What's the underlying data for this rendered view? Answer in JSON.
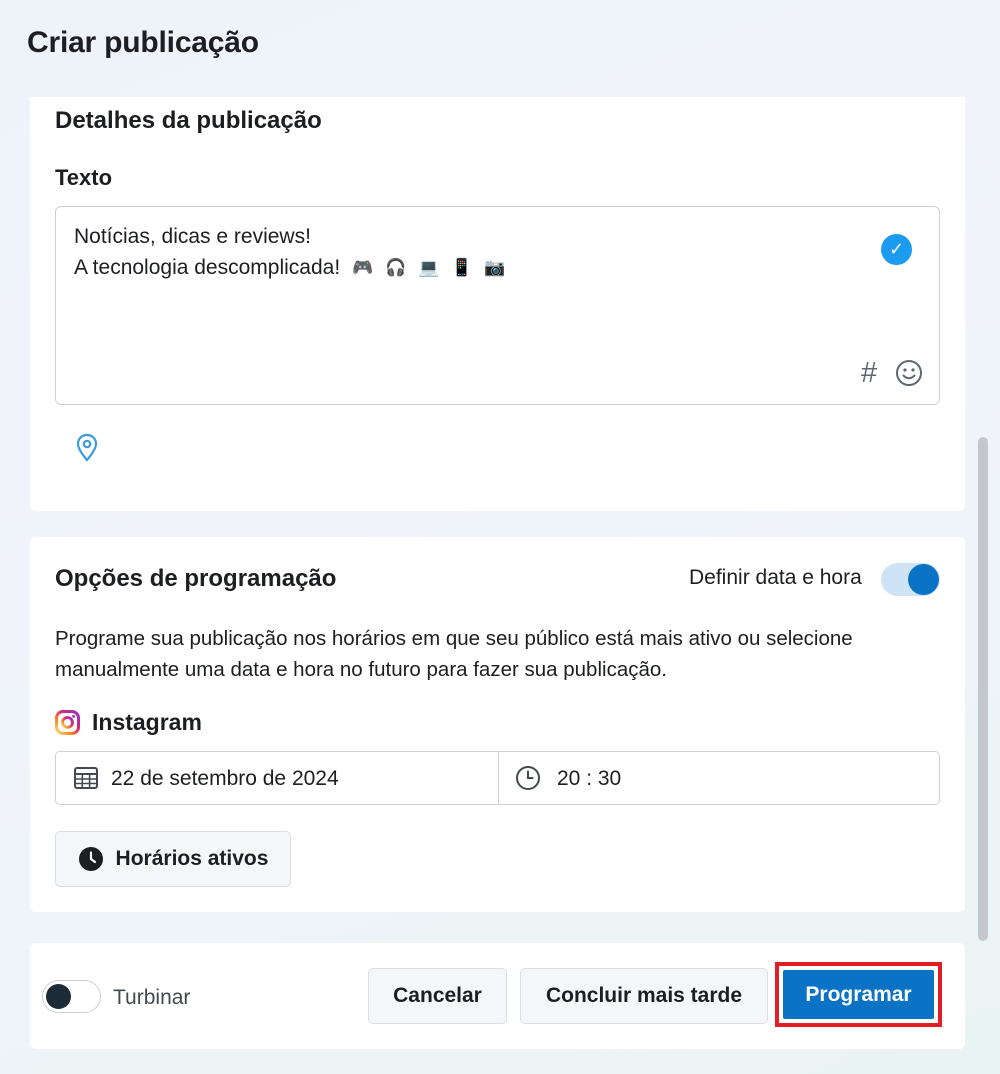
{
  "page": {
    "title": "Criar publicação"
  },
  "details": {
    "title": "Detalhes da publicação",
    "text_label": "Texto",
    "text_line1": "Notícias, dicas e reviews!",
    "text_line2": "A tecnologia descomplicada!",
    "emojis": [
      "🎮",
      "🎧",
      "💻",
      "📱",
      "📷"
    ],
    "hashtag_symbol": "#",
    "icons": [
      "check-circle-icon",
      "hashtag-icon",
      "emoji-icon",
      "location-pin-icon"
    ]
  },
  "schedule": {
    "title": "Opções de programação",
    "toggle_label": "Definir data e hora",
    "toggle_on": true,
    "description": "Programe sua publicação nos horários em que seu público está mais ativo ou selecione manualmente uma data e hora no futuro para fazer sua publicação.",
    "platform": "Instagram",
    "date": "22 de setembro de 2024",
    "time": "20 : 30",
    "active_times_button": "Horários ativos",
    "icons": [
      "instagram-icon",
      "calendar-icon",
      "clock-icon"
    ]
  },
  "footer": {
    "boost_label": "Turbinar",
    "boost_on": false,
    "cancel": "Cancelar",
    "finish_later": "Concluir mais tarde",
    "schedule": "Programar"
  },
  "colors": {
    "primary": "#0b73c5",
    "check": "#1d9bf0",
    "highlight": "#e11d26"
  }
}
